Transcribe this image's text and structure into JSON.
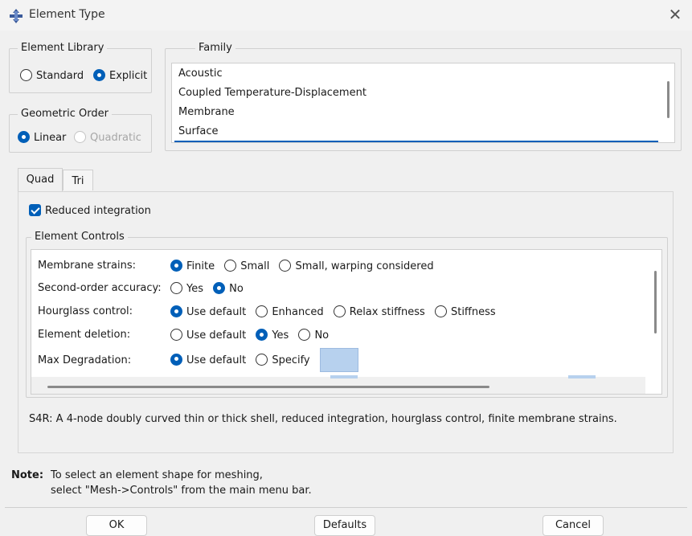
{
  "window": {
    "title": "Element Type",
    "close_glyph": "✕"
  },
  "element_library": {
    "legend": "Element Library",
    "options": [
      {
        "label": "Standard",
        "selected": false
      },
      {
        "label": "Explicit",
        "selected": true
      }
    ]
  },
  "geometric_order": {
    "legend": "Geometric Order",
    "options": [
      {
        "label": "Linear",
        "selected": true,
        "disabled": false
      },
      {
        "label": "Quadratic",
        "selected": false,
        "disabled": true
      }
    ]
  },
  "family": {
    "legend": "Family",
    "items": [
      "Acoustic",
      "Coupled Temperature-Displacement",
      "Membrane",
      "Surface"
    ],
    "selected": "Surface"
  },
  "tabs": [
    {
      "label": "Quad",
      "active": true
    },
    {
      "label": "Tri",
      "active": false
    }
  ],
  "reduced_integration": {
    "label": "Reduced integration",
    "checked": true
  },
  "element_controls": {
    "legend": "Element Controls",
    "rows": [
      {
        "label": "Membrane strains:",
        "options": [
          "Finite",
          "Small",
          "Small, warping considered"
        ],
        "selected": 0
      },
      {
        "label": "Second-order accuracy:",
        "options": [
          "Yes",
          "No"
        ],
        "selected": 1
      },
      {
        "label": "Hourglass control:",
        "options": [
          "Use default",
          "Enhanced",
          "Relax stiffness",
          "Stiffness"
        ],
        "selected": 0
      },
      {
        "label": "Element deletion:",
        "options": [
          "Use default",
          "Yes",
          "No"
        ],
        "selected": 1
      },
      {
        "label": "Max Degradation:",
        "options": [
          "Use default",
          "Specify"
        ],
        "selected": 0
      }
    ]
  },
  "description": "S4R:  A 4-node doubly curved thin or thick shell, reduced integration, hourglass control, finite membrane strains.",
  "note": {
    "label": "Note:",
    "line1": "To select an element shape for meshing,",
    "line2": "select \"Mesh->Controls\" from the main menu bar."
  },
  "buttons": {
    "ok": "OK",
    "defaults": "Defaults",
    "cancel": "Cancel"
  },
  "colors": {
    "accent": "#005fb8",
    "specify_field": "#b7d1ee"
  }
}
